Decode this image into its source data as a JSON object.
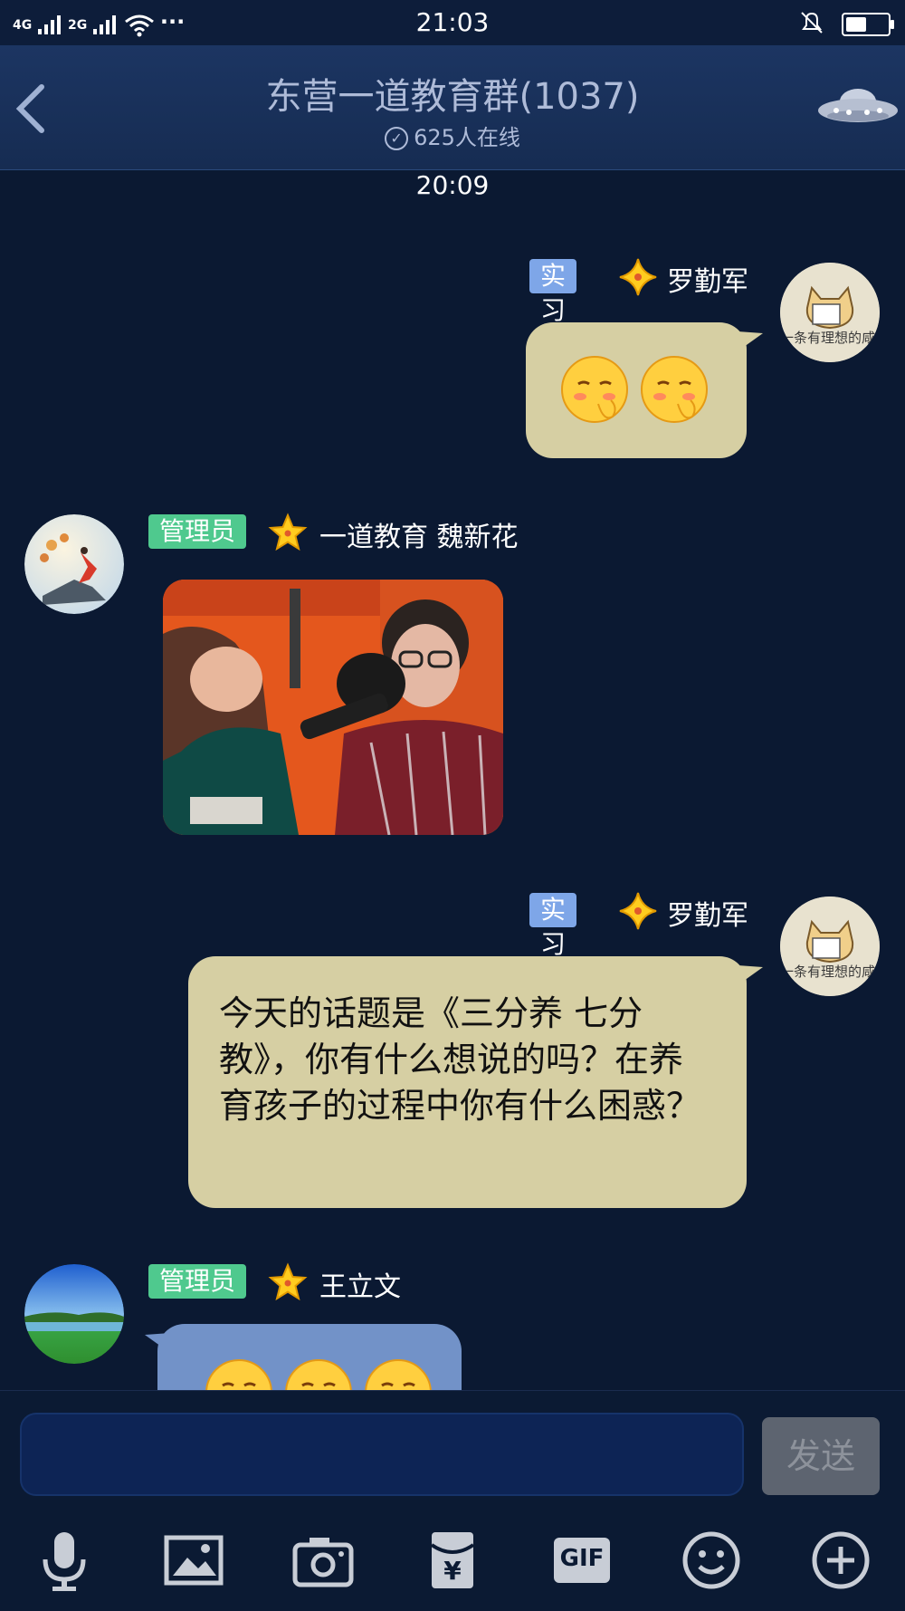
{
  "status_bar": {
    "signal_left": "4G",
    "signal_right": "2G",
    "dots": "···",
    "time": "21:03"
  },
  "header": {
    "back_label": "‹",
    "title": "东营一道教育群(1037)",
    "online": "625人在线"
  },
  "timestamp": "20:09",
  "messages": [
    {
      "tag": "实习",
      "name": "罗勤军",
      "avatar_text": "一条有理想的咸"
    },
    {
      "tag": "管理员",
      "name": "一道教育 魏新花"
    },
    {
      "tag": "实习",
      "name": "罗勤军",
      "avatar_text": "一条有理想的咸",
      "text": "今天的话题是《三分养 七分教》，你有什么想说的吗？在养育孩子的过程中你有什么困惑？"
    },
    {
      "tag": "管理员",
      "name": "王立文"
    }
  ],
  "composer": {
    "input_value": "",
    "send_label": "发送"
  },
  "toolbar": {
    "gif_label": "GIF",
    "yen": "¥"
  },
  "colors": {
    "background": "#0b1932",
    "bubble_self": "#d6cfa3",
    "bubble_other": "#7292c8",
    "tag_admin": "#4fc98e",
    "tag_intern": "#7ea6e8"
  }
}
